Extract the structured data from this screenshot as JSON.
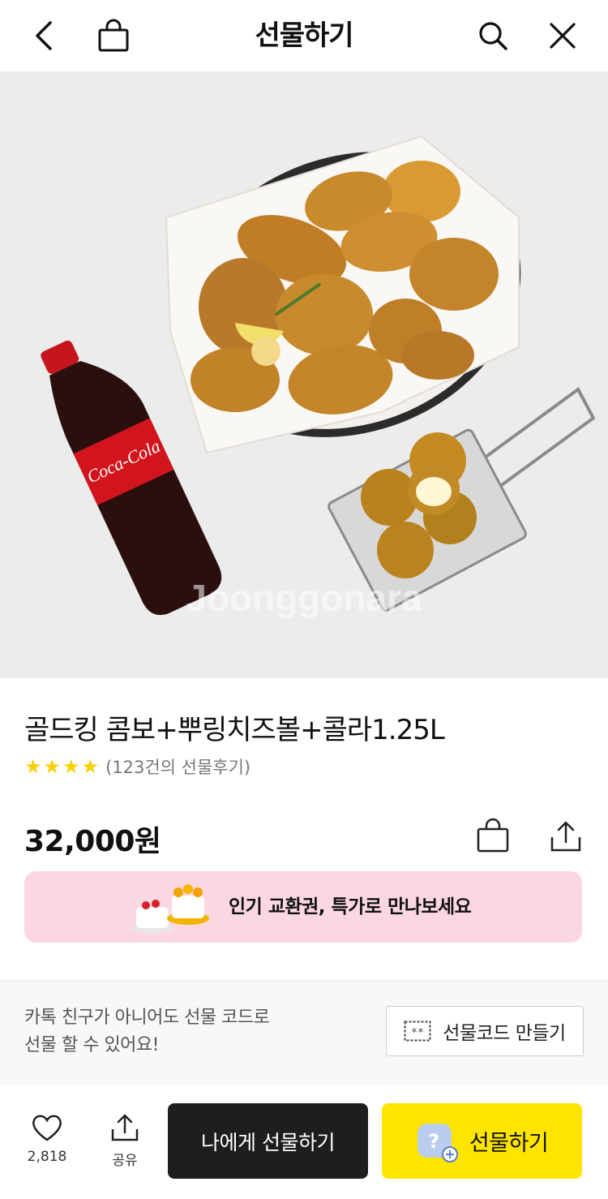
{
  "header": {
    "title": "선물하기",
    "icons": [
      "back-icon",
      "shopping-bag-icon",
      "search-icon",
      "close-icon"
    ]
  },
  "hero": {
    "watermark": "Joonggonara"
  },
  "product": {
    "name": "골드킹 콤보+뿌링치즈볼+콜라1.25L",
    "rating_stars": 4,
    "review_count": "(123건의 선물후기)",
    "price": "32,000원"
  },
  "banner": {
    "text": "인기 교환권, 특가로 만나보세요"
  },
  "gift_code": {
    "desc_line1": "카톡 친구가 아니어도 선물 코드로",
    "desc_line2": "선물 할 수 있어요!",
    "button_label": "선물코드 만들기"
  },
  "bottom": {
    "like_count": "2,818",
    "share_label": "공유",
    "gift_me_label": "나에게 선물하기",
    "gift_label": "선물하기"
  },
  "colors": {
    "star": "#f7cf00",
    "banner_bg": "#fbd7e2",
    "gift_button": "#fee500",
    "gift_me_button": "#1e1e1e"
  }
}
